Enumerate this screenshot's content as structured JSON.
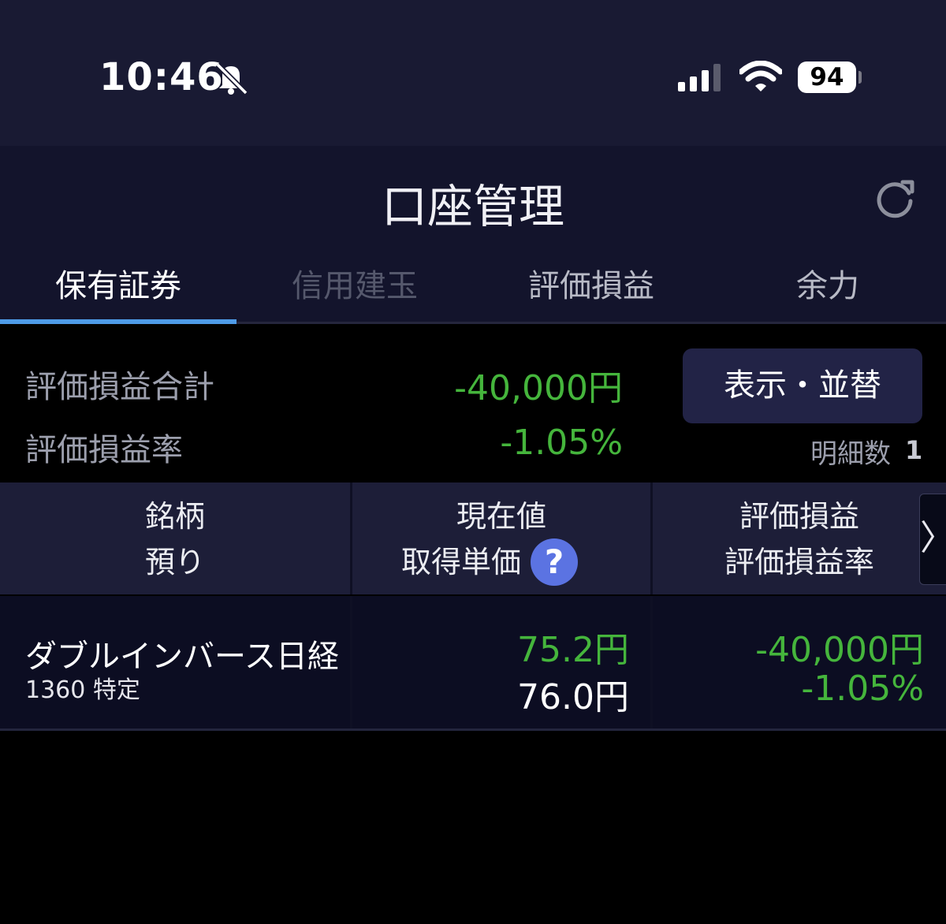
{
  "status_bar": {
    "time": "10:46",
    "battery": "94",
    "icons": [
      "bell-off-icon",
      "signal-icon",
      "wifi-icon",
      "battery-icon"
    ]
  },
  "header": {
    "title": "口座管理",
    "refresh_icon": "refresh-icon"
  },
  "tabs": [
    {
      "label": "保有証券",
      "active": true
    },
    {
      "label": "信用建玉",
      "active": false
    },
    {
      "label": "評価損益",
      "active": false
    },
    {
      "label": "余力",
      "active": false
    }
  ],
  "summary": {
    "total_pl_label": "評価損益合計",
    "total_pl_value": "-40,000円",
    "pl_rate_label": "評価損益率",
    "pl_rate_value": "-1.05%",
    "sort_button_label": "表示・並替",
    "detail_count_label": "明細数",
    "detail_count_value": "1"
  },
  "table": {
    "headers": [
      {
        "line1": "銘柄",
        "line2": "預り"
      },
      {
        "line1": "現在値",
        "line2": "取得単価",
        "help": "?"
      },
      {
        "line1": "評価損益",
        "line2": "評価損益率"
      }
    ],
    "more_icon": "chevron-right-icon",
    "rows": [
      {
        "name": "ダブルインバース日経",
        "code": "1360 特定",
        "current_price": "75.2円",
        "acquisition_price": "76.0円",
        "pl": "-40,000円",
        "pl_rate": "-1.05%"
      }
    ]
  },
  "colors": {
    "loss_value": "#45b53c",
    "tab_active_underline": "#4e9be8",
    "help_icon_bg": "#5b73e2"
  }
}
